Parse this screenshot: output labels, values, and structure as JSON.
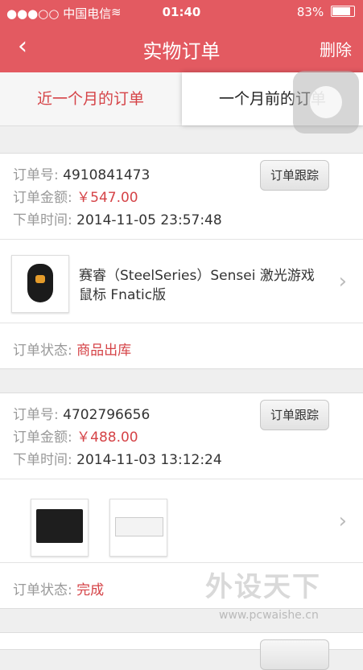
{
  "status_bar": {
    "carrier": "●●●○○ 中国电信",
    "wifi": "wifi-icon",
    "time": "01:40",
    "battery_pct": "83%"
  },
  "navbar": {
    "back_icon": "chevron-left-icon",
    "title": "实物订单",
    "right_label": "删除"
  },
  "tabs": [
    {
      "label": "近一个月的订单"
    },
    {
      "label": "一个月前的订单"
    }
  ],
  "labels": {
    "order_no": "订单号:",
    "amount": "订单金额:",
    "time": "下单时间:",
    "status": "订单状态:",
    "track": "订单跟踪"
  },
  "orders": [
    {
      "order_no": "4910841473",
      "amount": "￥547.00",
      "time": "2014-11-05 23:57:48",
      "product_title": "赛睿（SteelSeries）Sensei 激光游戏鼠标 Fnatic版",
      "status": "商品出库"
    },
    {
      "order_no": "4702796656",
      "amount": "￥488.00",
      "time": "2014-11-03 13:12:24",
      "status": "完成"
    }
  ],
  "watermark": {
    "text": "外设天下",
    "url": "www.pcwaishe.cn"
  },
  "colors": {
    "accent": "#e35a61",
    "price": "#d54347"
  }
}
